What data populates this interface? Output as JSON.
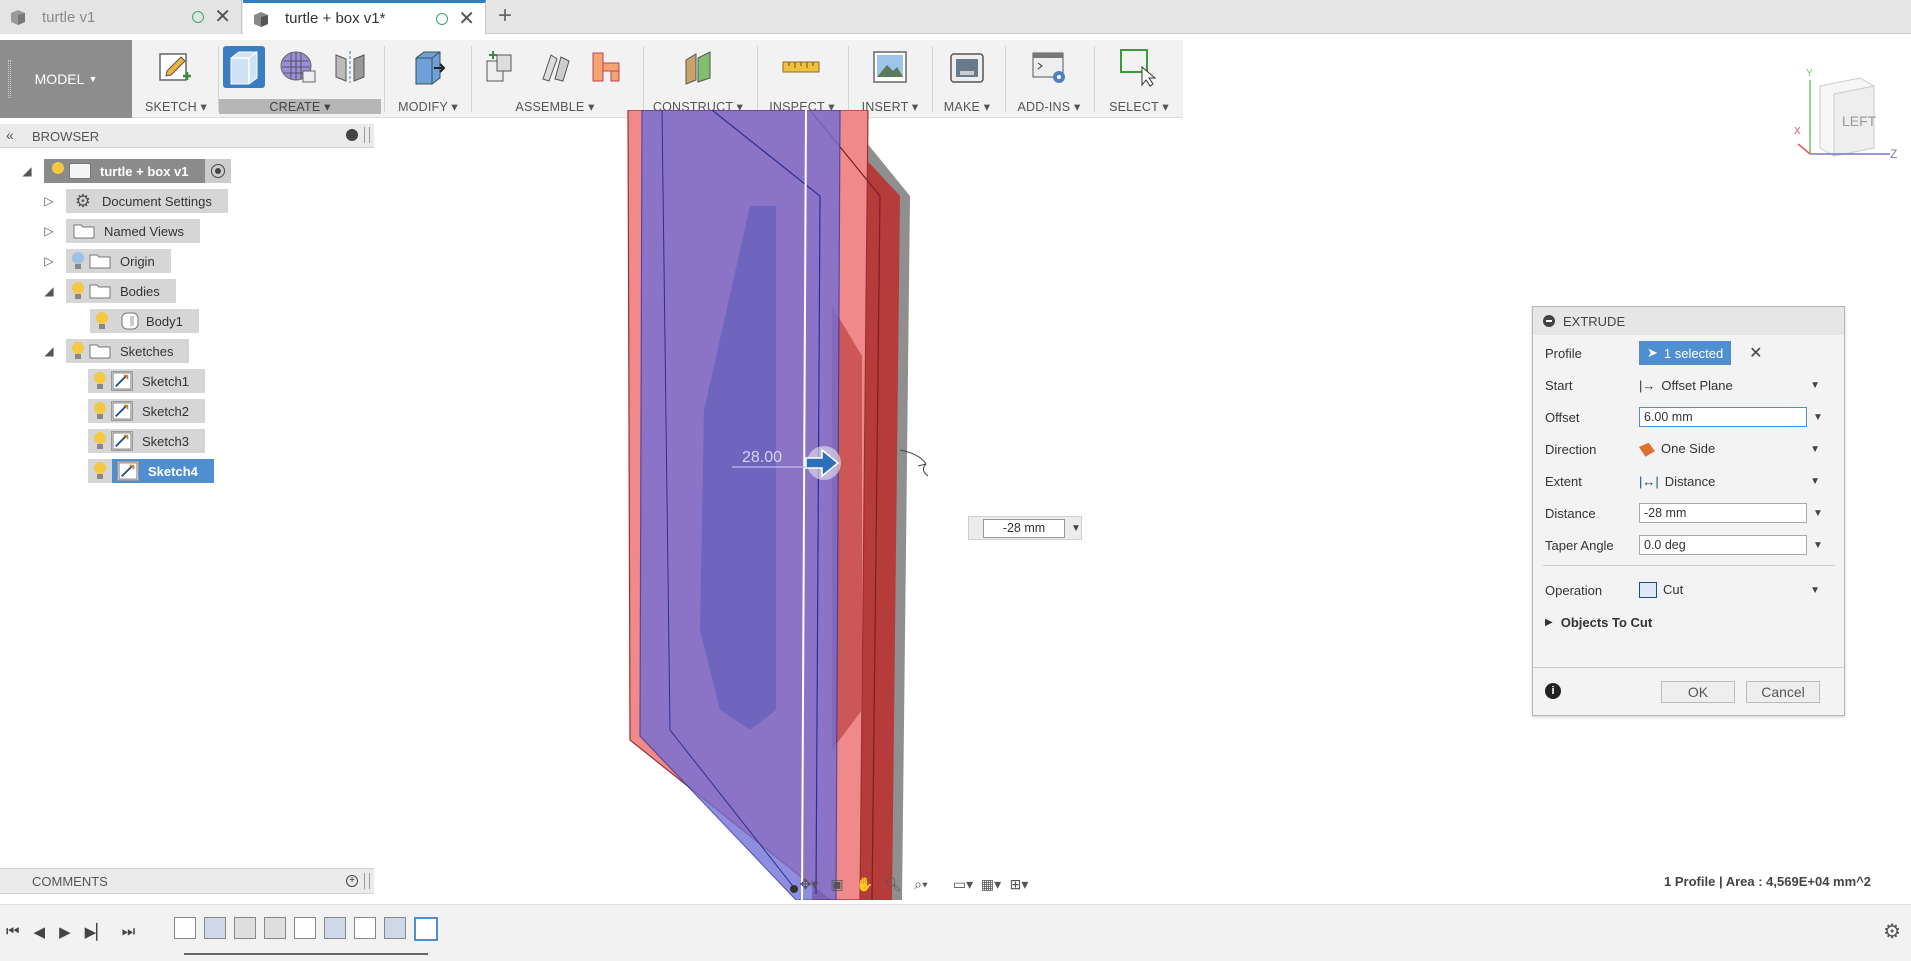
{
  "tabs": [
    {
      "label": "turtle v1",
      "active": false
    },
    {
      "label": "turtle + box v1*",
      "active": true
    }
  ],
  "toolbar": {
    "workspace": "MODEL",
    "groups": [
      {
        "label": "SKETCH"
      },
      {
        "label": "CREATE"
      },
      {
        "label": "MODIFY"
      },
      {
        "label": "ASSEMBLE"
      },
      {
        "label": "CONSTRUCT"
      },
      {
        "label": "INSPECT"
      },
      {
        "label": "INSERT"
      },
      {
        "label": "MAKE"
      },
      {
        "label": "ADD-INS"
      },
      {
        "label": "SELECT"
      }
    ]
  },
  "browser": {
    "title": "BROWSER",
    "root": "turtle + box v1",
    "items": [
      {
        "label": "Document Settings"
      },
      {
        "label": "Named Views"
      },
      {
        "label": "Origin"
      },
      {
        "label": "Bodies"
      },
      {
        "label": "Body1"
      },
      {
        "label": "Sketches"
      },
      {
        "label": "Sketch1"
      },
      {
        "label": "Sketch2"
      },
      {
        "label": "Sketch3"
      },
      {
        "label": "Sketch4"
      }
    ]
  },
  "comments": {
    "title": "COMMENTS"
  },
  "viewcube": {
    "face": "LEFT"
  },
  "viewport": {
    "dimension_label": "28.00",
    "distance_value": "-28 mm"
  },
  "extrude": {
    "title": "EXTRUDE",
    "profile_label": "Profile",
    "profile_value": "1 selected",
    "start_label": "Start",
    "start_value": "Offset Plane",
    "offset_label": "Offset",
    "offset_value": "6.00 mm",
    "direction_label": "Direction",
    "direction_value": "One Side",
    "extent_label": "Extent",
    "extent_value": "Distance",
    "distance_label": "Distance",
    "distance_value": "-28 mm",
    "taper_label": "Taper Angle",
    "taper_value": "0.0 deg",
    "operation_label": "Operation",
    "operation_value": "Cut",
    "objects_label": "Objects To Cut",
    "ok_label": "OK",
    "cancel_label": "Cancel"
  },
  "status": "1 Profile | Area : 4,569E+04 mm^2",
  "colors": {
    "accent": "#4f8fcf",
    "cut_body": "#f08a8a",
    "profile": "#6f6fd8"
  }
}
